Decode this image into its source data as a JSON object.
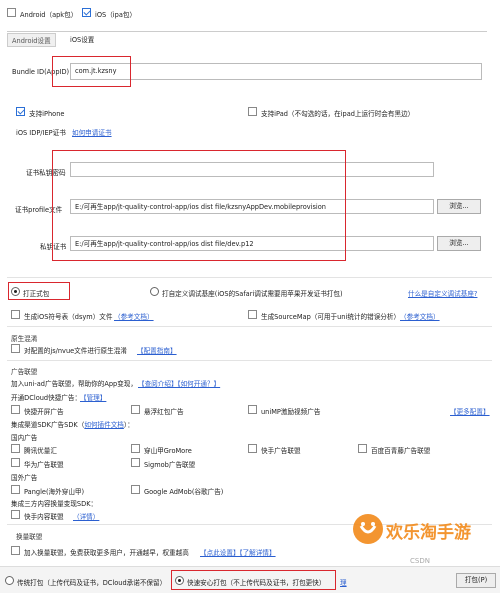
{
  "platforms": {
    "android": "Android（apk包）",
    "ios": "iOS（ipa包）"
  },
  "tabs": [
    "Android设置",
    "iOS设置"
  ],
  "bundle": {
    "label": "Bundle ID(AppID)",
    "value": "com.jt.kzsny"
  },
  "devices": {
    "iphone": "支持iPhone",
    "ipad": "支持iPad（不勾选的话，在ipad上运行时会有黑边）"
  },
  "cert": {
    "idp_label": "iOS IDP/IEP证书",
    "apply_link": "如何申请证书",
    "password_label": "证书私钥密码",
    "password_value": "",
    "profile_label": "证书profile文件",
    "profile_value": "E:/可再生app/jt-quality-control-app/ios dist file/kzsnyAppDev.mobileprovision",
    "private_label": "私钥证书",
    "private_value": "E:/可再生app/jt-quality-control-app/ios dist file/dev.p12",
    "browse": "浏览..."
  },
  "build_type": {
    "formal": "打正式包",
    "custom": "打自定义调试基座(iOS的Safari调试需要用苹果开发证书打包)",
    "custom_link": "什么是自定义调试基座?"
  },
  "symbols": {
    "dsym": "生成iOS符号表（dsym）文件",
    "dsym_link": "（参考文档）",
    "sourcemap": "生成SourceMap（可用于uni统计的错误分析）",
    "sourcemap_link": "（参考文档）"
  },
  "native": {
    "title": "原生混淆",
    "item": "对配置的js/nvue文件进行原生混淆",
    "link": "【配置指南】"
  },
  "ads": {
    "title": "广告联盟",
    "intro": "加入uni-ad广告联盟，帮助你的App变现，",
    "intro_link1": "【查阅介绍】",
    "intro_link2": "【如何开通？】",
    "dcloud": "开通DCloud快捷广告：",
    "dcloud_link": "【管理】",
    "quick": [
      "快捷开屏广告",
      "悬浮红包广告",
      "uniMP激励视频广告"
    ],
    "more": "【更多配置】",
    "sdk_label": "集成渠道SDK广告SDK（",
    "sdk_link": "如何插件文档",
    "sdk_end": "）：",
    "domestic": "国内广告",
    "domestic_items": [
      "腾讯优量汇",
      "穿山甲GroMore",
      "快手广告联盟",
      "百度百青藤广告联盟",
      "华为广告联盟",
      "Sigmob广告联盟"
    ],
    "overseas": "国外广告",
    "overseas_items": [
      "Pangle(海外穿山甲)",
      "Google AdMob(谷歌广告)"
    ],
    "third": "集成三方内容换量变现SDK：",
    "third_item": "快手内容联盟",
    "third_link": "（详情）"
  },
  "exchange": {
    "title": "换量联盟",
    "item": "加入换量联盟，免费获取更多用户，开通越早，权重越高",
    "link1": "【点此设置】",
    "link2": "【了解详情】"
  },
  "footer": {
    "traditional": "传统打包（上传代码及证书，DCloud承诺不保留）",
    "safe": "快速安心打包（不上传代码及证书，打包更快）",
    "extra": "理",
    "pack_button": "打包(P)"
  },
  "watermark": {
    "text": "欢乐淘手游",
    "small": "CSDN"
  }
}
